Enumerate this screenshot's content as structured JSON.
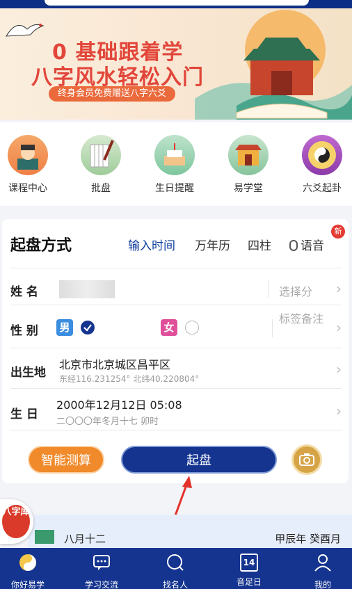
{
  "banner": {
    "line1": "0 基础跟着学",
    "line2": "八字风水轻松入门",
    "subtitle": "终身会员免费赠送八字六爻"
  },
  "icons": [
    {
      "label": "课程中心",
      "icon": "teacher-icon"
    },
    {
      "label": "批盘",
      "icon": "brush-icon"
    },
    {
      "label": "生日提醒",
      "icon": "cake-icon"
    },
    {
      "label": "易学堂",
      "icon": "temple-icon"
    },
    {
      "label": "六爻起卦",
      "icon": "bagua-icon"
    }
  ],
  "form": {
    "title": "起盘方式",
    "tabs": [
      "输入时间",
      "万年历",
      "四柱",
      "语音"
    ],
    "active_tab": "输入时间",
    "new_badge": "新",
    "name_label": "姓 名",
    "select_group": "选择分",
    "gender_label": "性 别",
    "male": "男",
    "female": "女",
    "tag_note": "标签备注",
    "birthplace_label": "出生地",
    "birthplace": "北京市北京城区昌平区",
    "coords": "东经116.231254° 北纬40.220804°",
    "birthday_label": "生 日",
    "birth_date": "2000年12月12日 05:08",
    "lunar_date": "二〇〇〇年冬月十七 卯时",
    "smart_button": "智能测算",
    "start_button": "起盘"
  },
  "float_badge": "八字库",
  "strip": {
    "lunar": "八月十二",
    "ganzhi": "甲辰年 癸酉月"
  },
  "nav": [
    {
      "label": "你好易学",
      "icon": "yin-yang-icon"
    },
    {
      "label": "学习交流",
      "icon": "chat-icon"
    },
    {
      "label": "找名人",
      "icon": "search-icon"
    },
    {
      "label": "音足日",
      "icon": "calendar-icon",
      "day": "14"
    },
    {
      "label": "我的",
      "icon": "user-icon"
    }
  ],
  "colors": {
    "primary": "#14348f",
    "accent_red": "#e2463a",
    "orange": "#f08a2a",
    "male_blue": "#3b8de0",
    "female_pink": "#e0509a"
  }
}
